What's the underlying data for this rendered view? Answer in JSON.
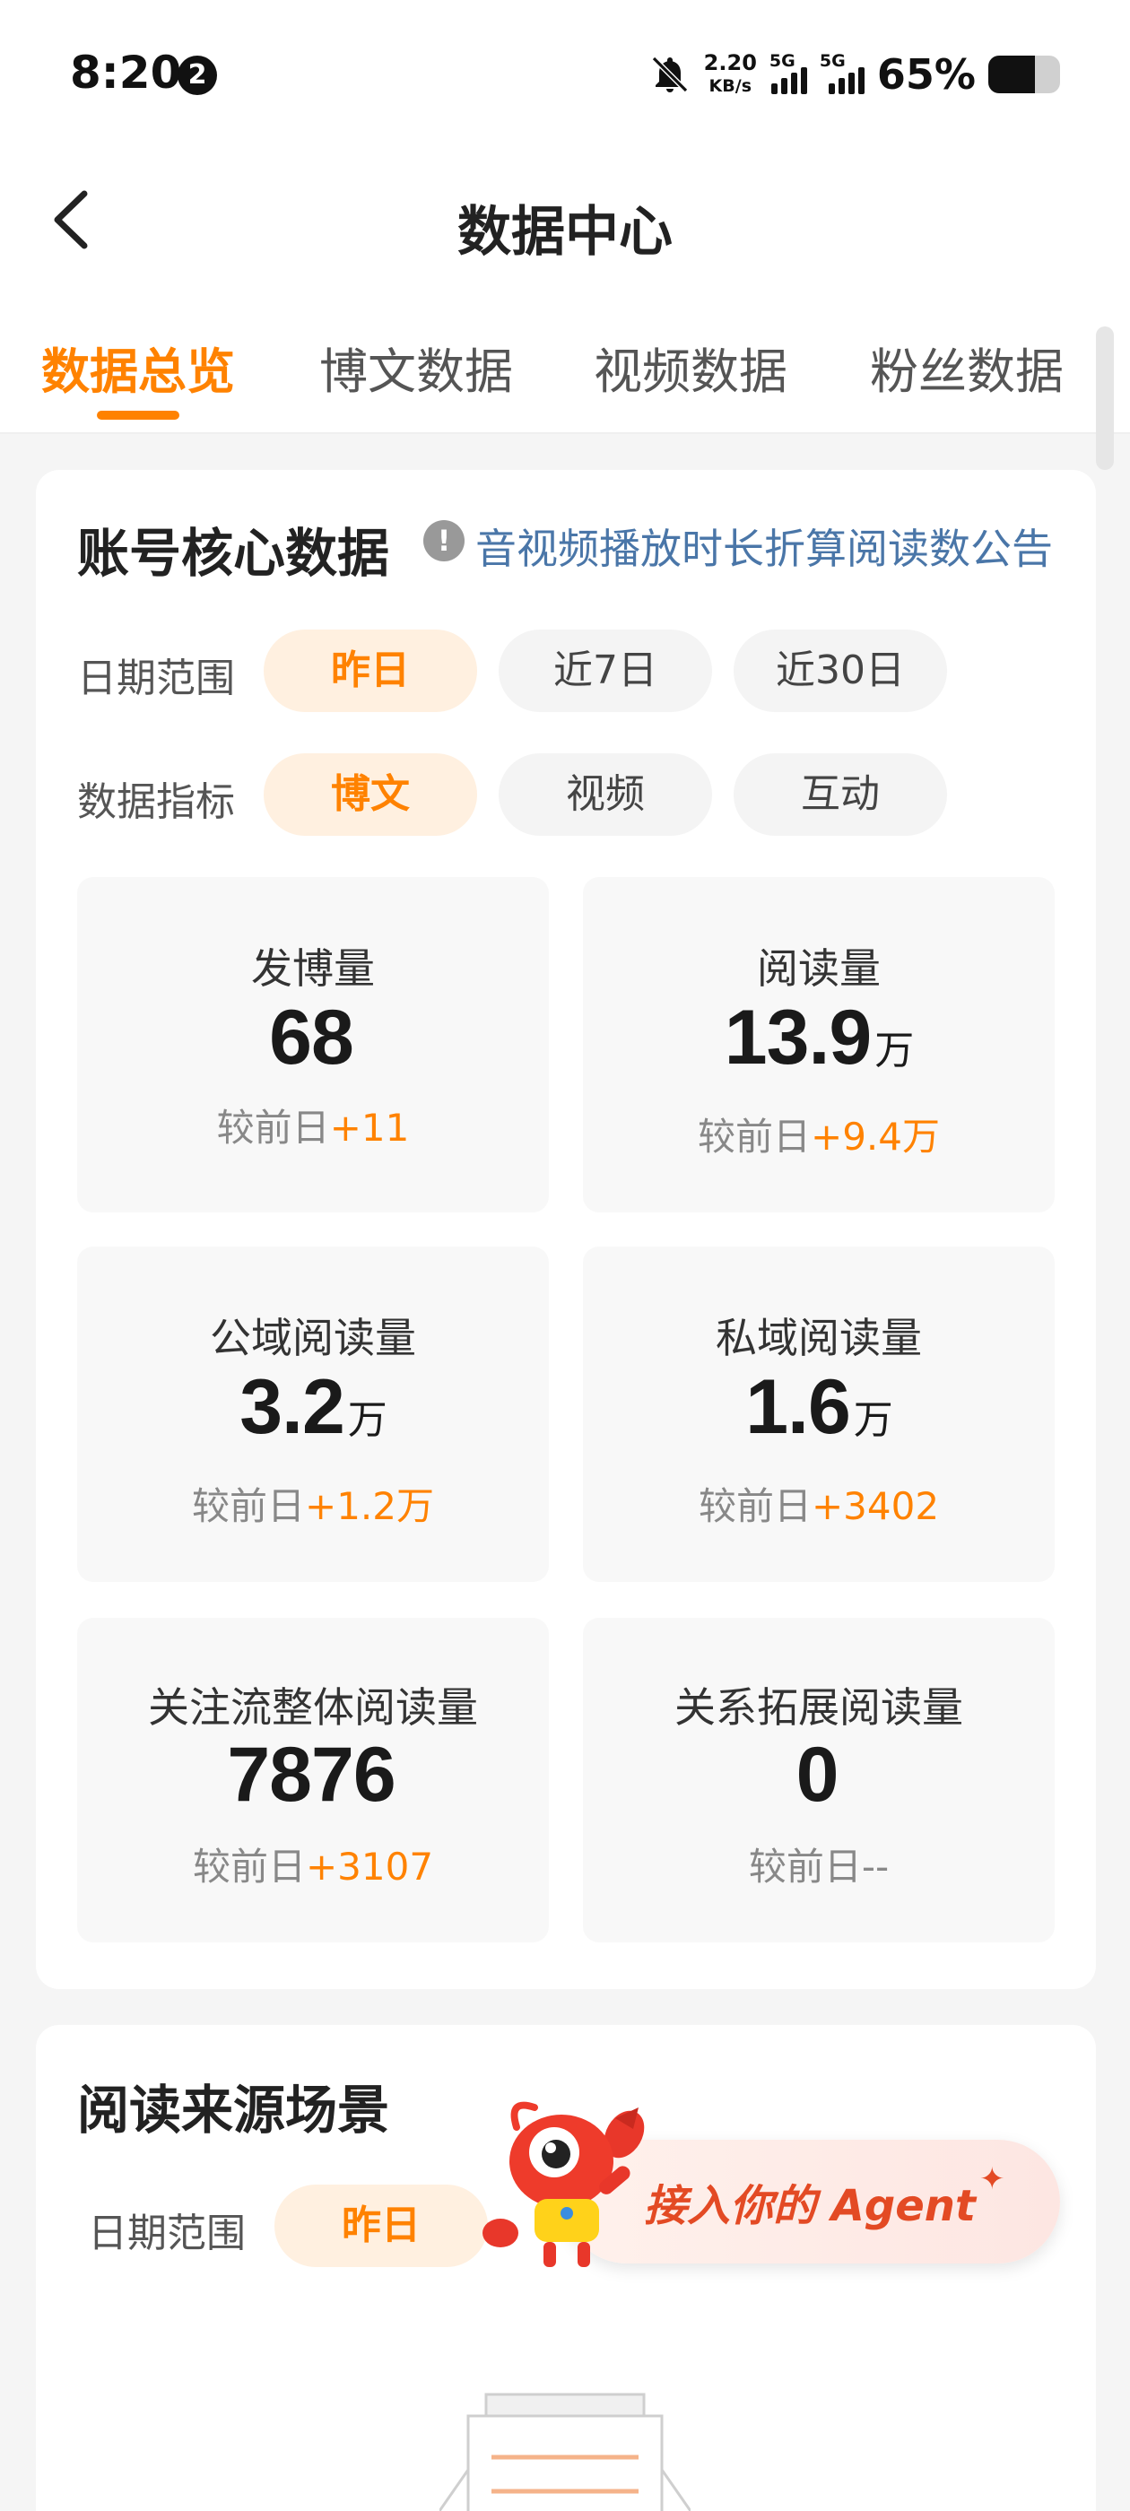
{
  "status_bar": {
    "time": "8:20",
    "notification_count": "2",
    "net_speed_value": "2.20",
    "net_speed_unit": "KB/s",
    "signal1_label": "5G",
    "signal2_label": "5G",
    "battery_text": "65%",
    "battery_level": 0.65
  },
  "header": {
    "title": "数据中心",
    "back_icon": "chevron-left-icon"
  },
  "tabs": [
    {
      "label": "数据总览",
      "active": true
    },
    {
      "label": "博文数据",
      "active": false
    },
    {
      "label": "视频数据",
      "active": false
    },
    {
      "label": "粉丝数据",
      "active": false
    }
  ],
  "core_section": {
    "title": "账号核心数据",
    "notice_icon": "!",
    "notice_link": "音视频播放时长折算阅读数公告",
    "date_range_label": "日期范围",
    "date_options": [
      "昨日",
      "近7日",
      "近30日"
    ],
    "metric_label": "数据指标",
    "metric_options": [
      "博文",
      "视频",
      "互动"
    ],
    "stats": [
      {
        "label": "发博量",
        "value": "68",
        "unit": "",
        "compare_prefix": "较前日",
        "delta": "+11"
      },
      {
        "label": "阅读量",
        "value": "13.9",
        "unit": "万",
        "compare_prefix": "较前日",
        "delta": "+9.4万"
      },
      {
        "label": "公域阅读量",
        "value": "3.2",
        "unit": "万",
        "compare_prefix": "较前日",
        "delta": "+1.2万"
      },
      {
        "label": "私域阅读量",
        "value": "1.6",
        "unit": "万",
        "compare_prefix": "较前日",
        "delta": "+3402"
      },
      {
        "label": "关注流整体阅读量",
        "value": "7876",
        "unit": "",
        "compare_prefix": "较前日",
        "delta": "+3107"
      },
      {
        "label": "关系拓展阅读量",
        "value": "0",
        "unit": "",
        "compare_prefix": "较前日--",
        "delta": ""
      }
    ]
  },
  "source_section": {
    "title": "阅读来源场景",
    "date_range_label": "日期范围",
    "date_option": "昨日"
  },
  "agent_banner": {
    "text": "接入你的 Agent",
    "spark": "✦"
  },
  "colors": {
    "accent": "#ff8200",
    "link": "#4a76a8",
    "agent": "#e34a24"
  }
}
